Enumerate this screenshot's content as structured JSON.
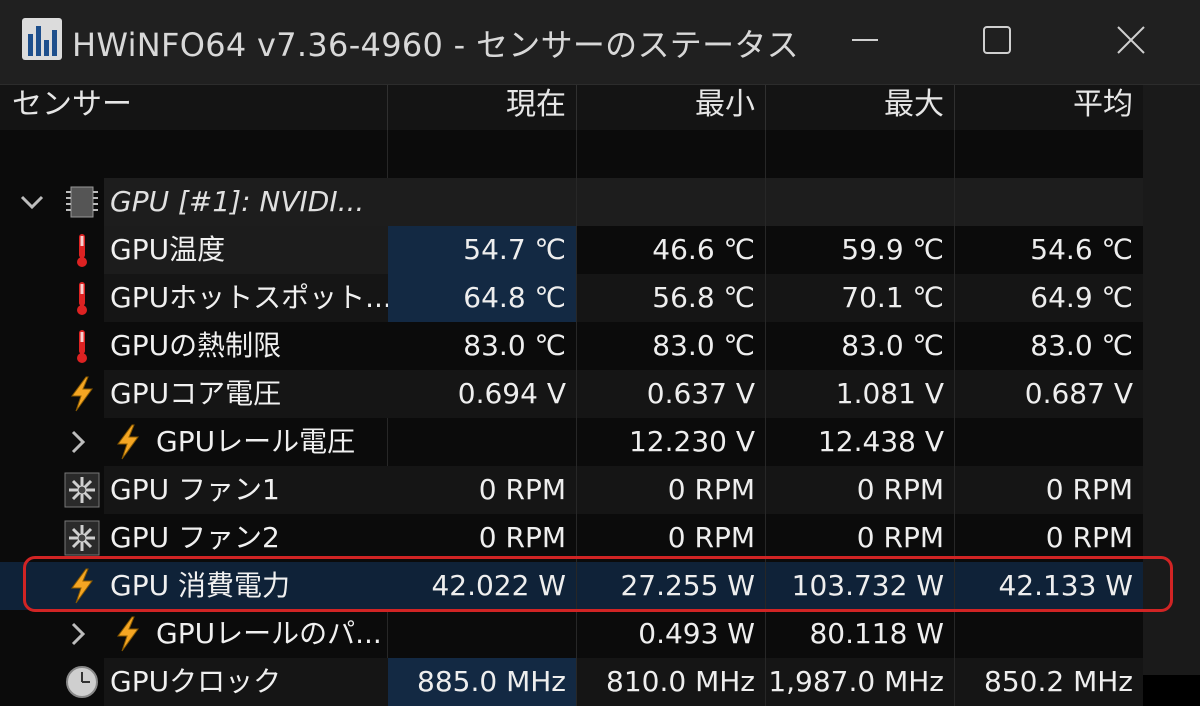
{
  "window": {
    "title": "HWiNFO64 v7.36-4960 - センサーのステータス",
    "minimize_glyph": "—",
    "maximize_glyph": "☐",
    "close_glyph": "✕"
  },
  "columns": {
    "sensor": "センサー",
    "current": "現在",
    "min": "最小",
    "max": "最大",
    "avg": "平均"
  },
  "group": {
    "name": "GPU [#1]: NVIDI...",
    "icon": "chip-icon"
  },
  "rows": [
    {
      "name": "GPU温度",
      "icon": "thermometer-icon",
      "current": "54.7 ℃",
      "min": "46.6 ℃",
      "max": "59.9 ℃",
      "avg": "54.6 ℃"
    },
    {
      "name": "GPUホットスポット...",
      "icon": "thermometer-icon",
      "current": "64.8 ℃",
      "min": "56.8 ℃",
      "max": "70.1 ℃",
      "avg": "64.9 ℃"
    },
    {
      "name": "GPUの熱制限",
      "icon": "thermometer-icon",
      "current": "83.0 ℃",
      "min": "83.0 ℃",
      "max": "83.0 ℃",
      "avg": "83.0 ℃"
    },
    {
      "name": "GPUコア電圧",
      "icon": "lightning-icon",
      "current": "0.694 V",
      "min": "0.637 V",
      "max": "1.081 V",
      "avg": "0.687 V"
    },
    {
      "name": "GPUレール電圧",
      "icon": "lightning-icon",
      "current": "",
      "min": "12.230 V",
      "max": "12.438 V",
      "avg": ""
    },
    {
      "name": "GPU ファン1",
      "icon": "fan-icon",
      "current": "0 RPM",
      "min": "0 RPM",
      "max": "0 RPM",
      "avg": "0 RPM"
    },
    {
      "name": "GPU ファン2",
      "icon": "fan-icon",
      "current": "0 RPM",
      "min": "0 RPM",
      "max": "0 RPM",
      "avg": "0 RPM"
    },
    {
      "name": "GPU 消費電力",
      "icon": "lightning-icon",
      "current": "42.022 W",
      "min": "27.255 W",
      "max": "103.732 W",
      "avg": "42.133 W"
    },
    {
      "name": "GPUレールのパ...",
      "icon": "lightning-icon",
      "current": "",
      "min": "0.493 W",
      "max": "80.118 W",
      "avg": ""
    },
    {
      "name": "GPUクロック",
      "icon": "clock-icon",
      "current": "885.0 MHz",
      "min": "810.0 MHz",
      "max": "1,987.0 MHz",
      "avg": "850.2 MHz"
    }
  ],
  "colors": {
    "highlight": "#d12424",
    "selected_row": "#0f2238",
    "current_highlight": "#132943",
    "lightning": "#f5a623"
  }
}
